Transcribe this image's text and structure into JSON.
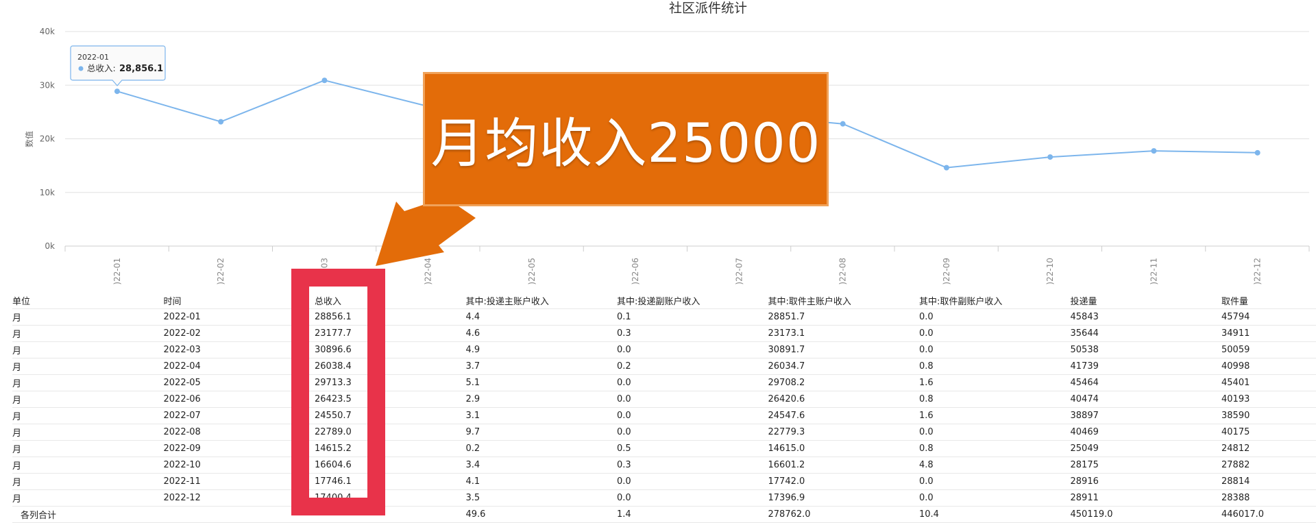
{
  "chart_data": {
    "type": "line",
    "title": "社区派件统计",
    "ylabel": "数值",
    "ylim": [
      0,
      40000
    ],
    "y_ticks": [
      "0k",
      "10k",
      "20k",
      "30k",
      "40k"
    ],
    "x_tick_labels": [
      ")22-01",
      ")22-02",
      "03",
      ")22-04",
      ")22-05",
      ")22-06",
      ")22-07",
      ")22-08",
      ")22-09",
      ")22-10",
      ")22-11",
      ")22-12"
    ],
    "x": [
      "2022-01",
      "2022-02",
      "2022-03",
      "2022-04",
      "2022-05",
      "2022-06",
      "2022-07",
      "2022-08",
      "2022-09",
      "2022-10",
      "2022-11",
      "2022-12"
    ],
    "series": [
      {
        "name": "总收入",
        "color": "#7cb5ec",
        "values": [
          28856.1,
          23177.7,
          30896.6,
          26038.4,
          29713.3,
          26423.5,
          24550.7,
          22789.0,
          14615.2,
          16604.6,
          17746.1,
          17400.4
        ]
      }
    ],
    "grid": true,
    "tooltip": {
      "date": "2022-01",
      "label": "总收入:",
      "value": "28,856.1"
    }
  },
  "annotation": {
    "text": "月均收入25000",
    "color": "#e36c09",
    "highlight_color": "#e8334a"
  },
  "table": {
    "headers": [
      "单位",
      "时间",
      "总收入",
      "其中:投递主账户收入",
      "其中:投递副账户收入",
      "其中:取件主账户收入",
      "其中:取件副账户收入",
      "投递量",
      "取件量"
    ],
    "rows": [
      [
        "月",
        "2022-01",
        "28856.1",
        "4.4",
        "0.1",
        "28851.7",
        "0.0",
        "45843",
        "45794"
      ],
      [
        "月",
        "2022-02",
        "23177.7",
        "4.6",
        "0.3",
        "23173.1",
        "0.0",
        "35644",
        "34911"
      ],
      [
        "月",
        "2022-03",
        "30896.6",
        "4.9",
        "0.0",
        "30891.7",
        "0.0",
        "50538",
        "50059"
      ],
      [
        "月",
        "2022-04",
        "26038.4",
        "3.7",
        "0.2",
        "26034.7",
        "0.8",
        "41739",
        "40998"
      ],
      [
        "月",
        "2022-05",
        "29713.3",
        "5.1",
        "0.0",
        "29708.2",
        "1.6",
        "45464",
        "45401"
      ],
      [
        "月",
        "2022-06",
        "26423.5",
        "2.9",
        "0.0",
        "26420.6",
        "0.8",
        "40474",
        "40193"
      ],
      [
        "月",
        "2022-07",
        "24550.7",
        "3.1",
        "0.0",
        "24547.6",
        "1.6",
        "38897",
        "38590"
      ],
      [
        "月",
        "2022-08",
        "22789.0",
        "9.7",
        "0.0",
        "22779.3",
        "0.0",
        "40469",
        "40175"
      ],
      [
        "月",
        "2022-09",
        "14615.2",
        "0.2",
        "0.5",
        "14615.0",
        "0.8",
        "25049",
        "24812"
      ],
      [
        "月",
        "2022-10",
        "16604.6",
        "3.4",
        "0.3",
        "16601.2",
        "4.8",
        "28175",
        "27882"
      ],
      [
        "月",
        "2022-11",
        "17746.1",
        "4.1",
        "0.0",
        "17742.0",
        "0.0",
        "28916",
        "28814"
      ],
      [
        "月",
        "2022-12",
        "17400.4",
        "3.5",
        "0.0",
        "17396.9",
        "0.0",
        "28911",
        "28388"
      ]
    ],
    "total_row": [
      "各列合计",
      "",
      "",
      "49.6",
      "1.4",
      "278762.0",
      "10.4",
      "450119.0",
      "446017.0"
    ]
  }
}
